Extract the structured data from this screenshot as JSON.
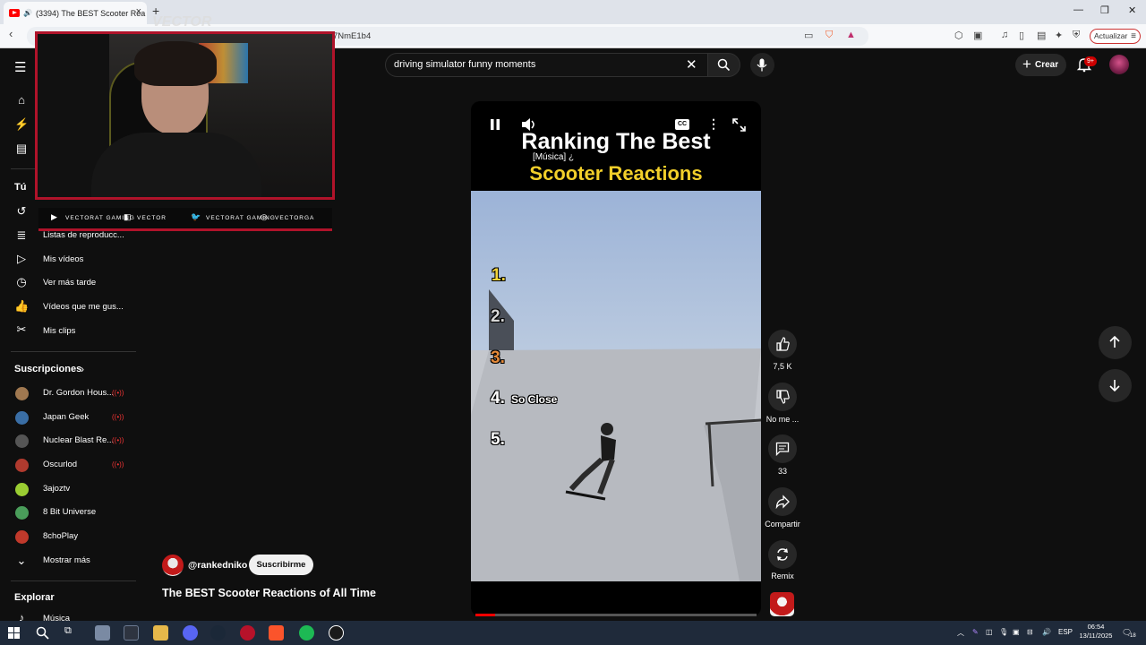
{
  "browser": {
    "tab_title": "(3394) The BEST Scooter Rea",
    "tab_close": "×",
    "new_tab": "+",
    "address_partial": "7NmE1b4",
    "update_label": "Actualizar"
  },
  "header": {
    "search_value": "driving simulator funny moments",
    "create_label": "Crear",
    "notif_badge": "9+"
  },
  "sidebar": {
    "you_heading": "Tú",
    "items": [
      {
        "label": "Listas de reproducc..."
      },
      {
        "label": "Mis vídeos"
      },
      {
        "label": "Ver más tarde"
      },
      {
        "label": "Vídeos que me gus..."
      },
      {
        "label": "Mis clips"
      }
    ],
    "subs_heading": "Suscripciones",
    "subscriptions": [
      {
        "name": "Dr. Gordon Hous...",
        "live": true,
        "color": "#a07850"
      },
      {
        "name": "Japan Geek",
        "live": true,
        "color": "#3a6ea5"
      },
      {
        "name": "Nuclear Blast Re...",
        "live": true,
        "color": "#555555"
      },
      {
        "name": "Oscurlod",
        "live": true,
        "color": "#b03a2e"
      },
      {
        "name": "3ajoztv",
        "live": false,
        "color": "#9acd32"
      },
      {
        "name": "8 Bit Universe",
        "live": false,
        "color": "#4a9d5a"
      },
      {
        "name": "8choPlay",
        "live": false,
        "color": "#c0392b"
      }
    ],
    "show_more": "Mostrar más",
    "explore_heading": "Explorar",
    "explore_first": "Música"
  },
  "overlay": {
    "logo_text": "VECTOR",
    "socials": [
      "VECTORAT GAMING",
      "VECTOR",
      "VECTORAT GAMING",
      "VECTORGA"
    ]
  },
  "video": {
    "title_line1": "Ranking The Best",
    "title_line2": "Scooter Reactions",
    "caption": "[Música] ¿",
    "ranks": [
      "1.",
      "2.",
      "3.",
      "4.",
      "5."
    ],
    "rank4_note": "So Close",
    "progress": 0.07
  },
  "channel": {
    "handle": "@rankedniko",
    "subscribe_label": "Suscribirme",
    "short_title": "The BEST Scooter Reactions of All Time"
  },
  "actions": {
    "likes": "7,5 K",
    "dislike_label": "No me ...",
    "comments": "33",
    "share_label": "Compartir",
    "remix_label": "Remix"
  },
  "taskbar": {
    "lang": "ESP",
    "time": "06:54",
    "date": "13/11/2025",
    "notif_count": "18"
  }
}
